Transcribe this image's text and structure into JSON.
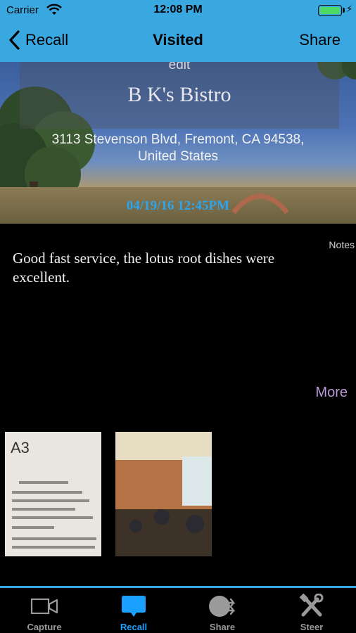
{
  "status_bar": {
    "carrier": "Carrier",
    "time": "12:08 PM",
    "battery_level": 1.0
  },
  "nav": {
    "back_label": "Recall",
    "title": "Visited",
    "share_label": "Share"
  },
  "place": {
    "edit_label": "edit",
    "name": "B K's Bistro",
    "address": "3113 Stevenson Blvd, Fremont, CA 94538, United States",
    "datetime": "04/19/16 12:45PM"
  },
  "notes": {
    "label": "Notes",
    "text": "Good fast service, the lotus root dishes were excellent.",
    "more_label": "More"
  },
  "thumbnails": {
    "receipt_text": "A3"
  },
  "tabs": [
    {
      "label": "Capture",
      "icon": "video-camera-icon",
      "active": false
    },
    {
      "label": "Recall",
      "icon": "speech-bubble-icon",
      "active": true
    },
    {
      "label": "Share",
      "icon": "share-icon",
      "active": false
    },
    {
      "label": "Steer",
      "icon": "tools-icon",
      "active": false
    }
  ],
  "colors": {
    "accent_blue": "#3aa8e0",
    "datetime_blue": "#2aa6f0",
    "more_purple": "#b89ad8",
    "active_tab": "#1aa0ff"
  }
}
